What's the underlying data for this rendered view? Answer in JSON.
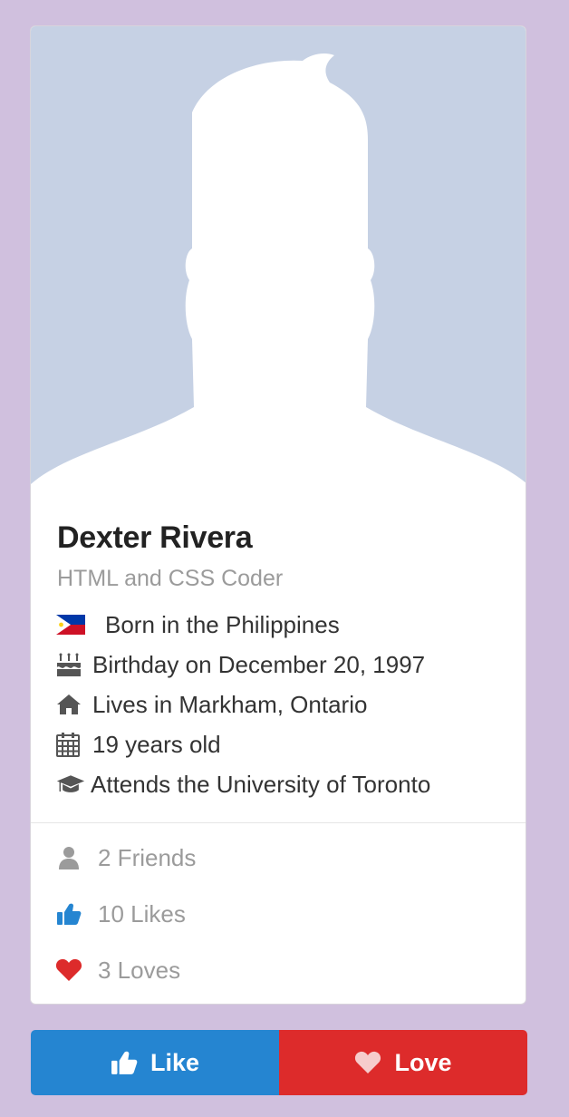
{
  "profile": {
    "name": "Dexter Rivera",
    "role": "HTML and CSS Coder"
  },
  "details": [
    {
      "icon": "philippines-flag-icon",
      "text": "Born in the Philippines"
    },
    {
      "icon": "birthday-cake-icon",
      "text": "Birthday on December 20, 1997"
    },
    {
      "icon": "home-icon",
      "text": "Lives in Markham, Ontario"
    },
    {
      "icon": "calendar-icon",
      "text": "19 years old"
    },
    {
      "icon": "graduation-cap-icon",
      "text": "Attends the University of Toronto"
    }
  ],
  "stats": [
    {
      "icon": "user-icon",
      "text": "2 Friends",
      "color": "#9b9b9b"
    },
    {
      "icon": "thumbs-up-icon",
      "text": "10 Likes",
      "color": "#2585d1"
    },
    {
      "icon": "heart-icon",
      "text": "3 Loves",
      "color": "#dd2b2b"
    }
  ],
  "actions": {
    "like_label": "Like",
    "love_label": "Love"
  },
  "colors": {
    "background": "#d0c0de",
    "like": "#2585d1",
    "love": "#dd2b2b",
    "avatar_bg": "#c6d1e4"
  }
}
